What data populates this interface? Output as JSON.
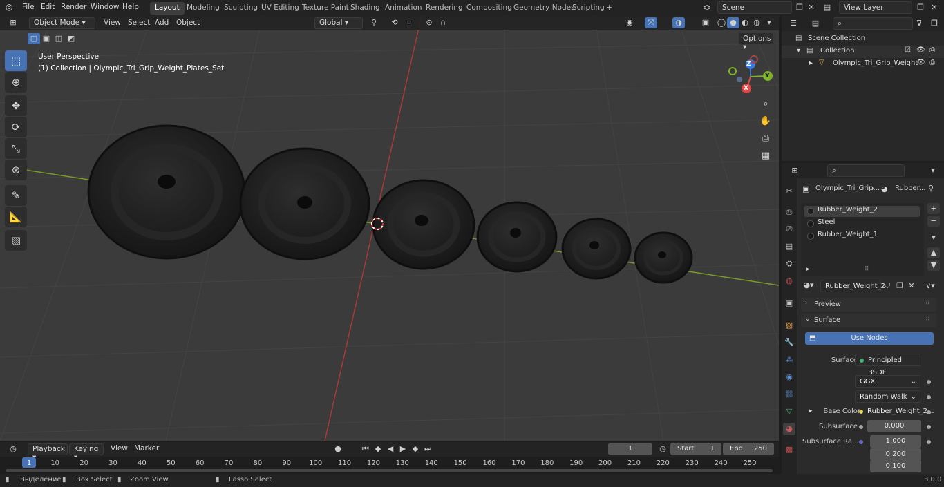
{
  "menus": [
    "File",
    "Edit",
    "Render",
    "Window",
    "Help"
  ],
  "workspaces": [
    "Layout",
    "Modeling",
    "Sculpting",
    "UV Editing",
    "Texture Paint",
    "Shading",
    "Animation",
    "Rendering",
    "Compositing",
    "Geometry Nodes",
    "Scripting"
  ],
  "add_workspace": "+",
  "scene": {
    "label": "Scene",
    "view_layer": "View Layer"
  },
  "viewport": {
    "mode": "Object Mode",
    "menus": [
      "View",
      "Select",
      "Add",
      "Object"
    ],
    "orientation": "Global",
    "options_label": "Options",
    "perspective_label": "User Perspective",
    "collection_label": "(1) Collection | Olympic_Tri_Grip_Weight_Plates_Set",
    "gizmo": {
      "x": "X",
      "y": "Y",
      "z": "Z"
    }
  },
  "outliner": {
    "scene_collection": "Scene Collection",
    "collection": "Collection",
    "object": "Olympic_Tri_Grip_Weight"
  },
  "properties": {
    "breadcrumb_object": "Olympic_Tri_Grip...",
    "breadcrumb_material": "Rubber...",
    "materials": [
      "Rubber_Weight_2",
      "Steel",
      "Rubber_Weight_1"
    ],
    "active_material": "Rubber_Weight_2",
    "panels": {
      "preview": "Preview",
      "surface": "Surface"
    },
    "use_nodes": "Use Nodes",
    "surface_label": "Surface",
    "surface_value": "Principled BSDF",
    "distribution": "GGX",
    "subsurface_method": "Random Walk",
    "base_color_label": "Base Color",
    "base_color_value": "Rubber_Weight_2...",
    "subsurface_label": "Subsurface",
    "subsurface_value": "0.000",
    "subsurface_radius_label": "Subsurface Ra...",
    "subsurface_radius": [
      "1.000",
      "0.200",
      "0.100"
    ]
  },
  "timeline": {
    "menus": [
      "Playback",
      "Keying",
      "View",
      "Marker"
    ],
    "current_frame": "1",
    "start_label": "Start",
    "start_value": "1",
    "end_label": "End",
    "end_value": "250",
    "ticks": [
      "1",
      "10",
      "20",
      "30",
      "40",
      "50",
      "60",
      "70",
      "80",
      "90",
      "100",
      "110",
      "120",
      "130",
      "140",
      "150",
      "160",
      "170",
      "180",
      "190",
      "200",
      "210",
      "220",
      "230",
      "240",
      "250"
    ]
  },
  "status": {
    "select": "Выделение",
    "box_select": "Box Select",
    "zoom_view": "Zoom View",
    "lasso_select": "Lasso Select",
    "version": "3.0.0"
  },
  "colors": {
    "accent": "#4772b3",
    "grid_red": "#a83a3a",
    "grid_green": "#7a9a2a"
  }
}
